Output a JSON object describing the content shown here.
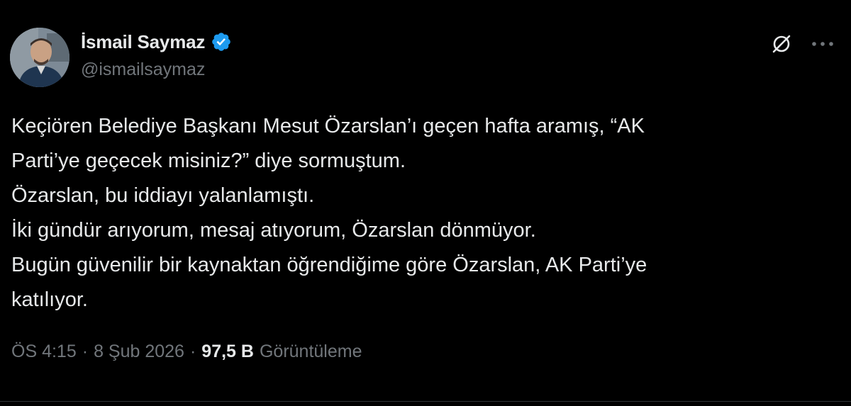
{
  "author": {
    "display_name": "İsmail Saymaz",
    "handle": "@ismailsaymaz",
    "verified": true
  },
  "tweet": {
    "lines": [
      "Keçiören Belediye Başkanı Mesut Özarslan’ı geçen hafta aramış, “AK",
      "Parti’ye geçecek misiniz?” diye sormuştum.",
      "Özarslan, bu iddiayı yalanlamıştı.",
      "İki gündür arıyorum, mesaj atıyorum, Özarslan dönmüyor.",
      "Bugün güvenilir bir kaynaktan öğrendiğime göre Özarslan, AK Parti’ye",
      "katılıyor."
    ]
  },
  "meta": {
    "time": "ÖS 4:15",
    "separator": "·",
    "date": "8 Şub 2026",
    "views_count": "97,5 B",
    "views_label": "Görüntüleme"
  },
  "icons": {
    "verified": "verified-badge-icon",
    "grok": "grok-icon",
    "more": "more-options-icon"
  },
  "colors": {
    "background": "#000000",
    "text_primary": "#e7e9ea",
    "text_secondary": "#71767b",
    "verified_blue": "#1d9bf0",
    "border": "#2f3336"
  }
}
